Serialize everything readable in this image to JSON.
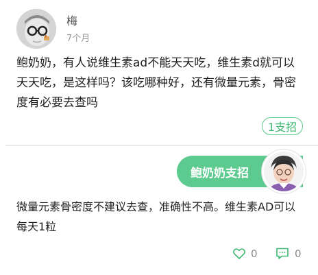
{
  "question_post": {
    "user_name": "梅",
    "time": "7个月",
    "text": "鲍奶奶，有人说维生素ad不能天天吃，维生素d就可以天天吃，是这样吗？该吃哪种好，还有微量元素，骨密度有必要去查吗",
    "support_button_label": "1支招"
  },
  "expert_reply": {
    "header_label": "鲍奶奶支招",
    "text": "微量元素骨密度不建议去查，准确性不高。维生素AD可以每天1粒",
    "like_count": "0",
    "comment_count": "0"
  },
  "colors": {
    "accent_green": "#5dcb8f",
    "support_border": "#5cc987",
    "icon_green": "#3fb872"
  },
  "icons": {
    "like": "heart-outline-icon",
    "comment": "comment-bubble-icon"
  }
}
